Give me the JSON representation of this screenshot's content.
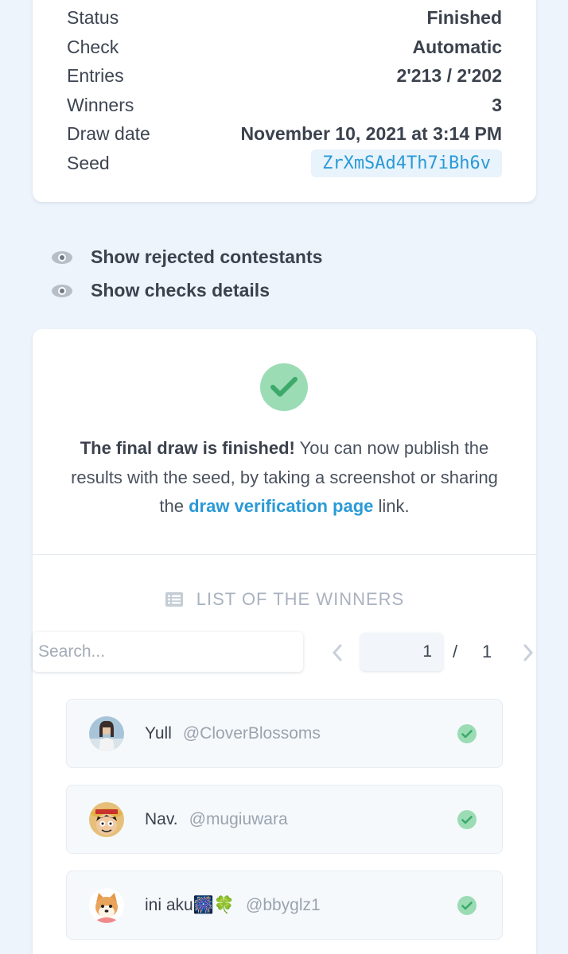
{
  "info": {
    "rows": [
      {
        "label": "Status",
        "value": "Finished"
      },
      {
        "label": "Check",
        "value": "Automatic"
      },
      {
        "label": "Entries",
        "value": "2'213 / 2'202"
      },
      {
        "label": "Winners",
        "value": "3"
      },
      {
        "label": "Draw date",
        "value": "November 10, 2021 at 3:14 PM"
      },
      {
        "label": "Seed",
        "value": "ZrXmSAd4Th7iBh6v"
      }
    ]
  },
  "toggles": {
    "rejected": "Show rejected contestants",
    "checks": "Show checks details"
  },
  "result": {
    "bold": "The final draw is finished!",
    "text": " You can now publish the results with the seed, by taking a screenshot or sharing the ",
    "link": "draw verification page",
    "suffix": " link."
  },
  "winners_section": {
    "title": "LIST OF THE WINNERS",
    "search_placeholder": "Search...",
    "page_current": "1",
    "page_separator": "/",
    "page_total": "1"
  },
  "winners": [
    {
      "name": "Yull",
      "handle": "@CloverBlossoms"
    },
    {
      "name": "Nav.",
      "handle": "@mugiuwara"
    },
    {
      "name": "ini aku🎆🍀",
      "handle": "@bbyglz1"
    }
  ],
  "colors": {
    "accent": "#2a9ad6",
    "success": "#9bdcb5",
    "success_dark": "#3daa6a",
    "background": "#eef4fc"
  }
}
